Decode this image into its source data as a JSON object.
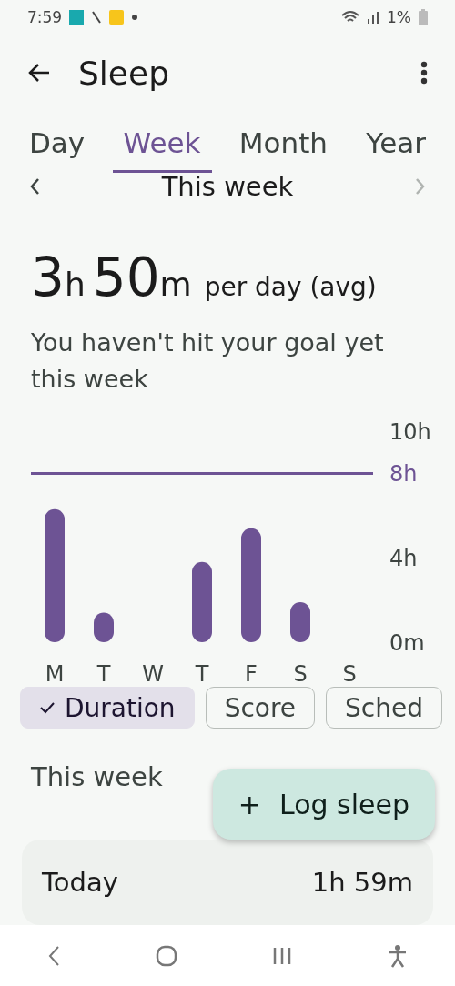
{
  "status_bar": {
    "time": "7:59",
    "battery": "1%"
  },
  "app_bar": {
    "title": "Sleep"
  },
  "tabs": [
    {
      "label": "Day",
      "selected": false
    },
    {
      "label": "Week",
      "selected": true
    },
    {
      "label": "Month",
      "selected": false
    },
    {
      "label": "Year",
      "selected": false
    }
  ],
  "period": {
    "label": "This week",
    "next_disabled": true
  },
  "summary": {
    "hours": "3",
    "hours_unit": "h",
    "minutes": "50",
    "minutes_unit": "m",
    "suffix": "per day (avg)",
    "message": "You haven't hit your goal yet this week"
  },
  "chart": {
    "chart_data": {
      "type": "bar",
      "categories": [
        "M",
        "T",
        "W",
        "T",
        "F",
        "S",
        "S"
      ],
      "series": [
        {
          "color": "#6d5394",
          "values": [
            6.3,
            1.4,
            null,
            3.8,
            5.4,
            1.9,
            null
          ]
        }
      ],
      "ylim": [
        0,
        10
      ],
      "yticks": [
        {
          "value": 0,
          "label": "0m"
        },
        {
          "value": 4,
          "label": "4h"
        },
        {
          "value": 8,
          "label": "8h"
        },
        {
          "value": 10,
          "label": "10h"
        }
      ],
      "ref_lines": [
        {
          "axis": "y",
          "value": 8,
          "color": "#6d5394"
        }
      ]
    }
  },
  "chips": [
    {
      "label": "Duration",
      "selected": true
    },
    {
      "label": "Score",
      "selected": false
    },
    {
      "label": "Sched",
      "selected": false
    }
  ],
  "list": {
    "heading": "This week",
    "rows": [
      {
        "label": "Today",
        "value": "1h 59m"
      }
    ]
  },
  "fab": {
    "label": "Log sleep",
    "icon": "+"
  }
}
